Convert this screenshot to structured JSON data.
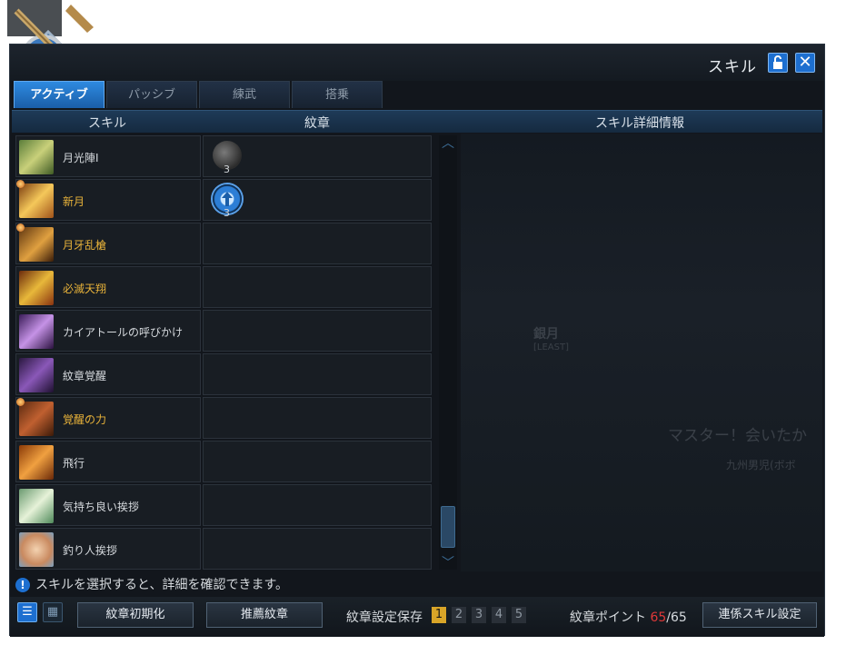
{
  "window": {
    "title": "スキル",
    "tabs": [
      {
        "label": "アクティブ",
        "active": true
      },
      {
        "label": "パッシブ",
        "active": false
      },
      {
        "label": "練武",
        "active": false
      },
      {
        "label": "搭乗",
        "active": false
      }
    ],
    "columns": {
      "skill": "スキル",
      "emblem": "紋章",
      "detail": "スキル詳細情報"
    }
  },
  "skills": [
    {
      "name": "月光陣Ⅰ",
      "gold": false,
      "marked": false,
      "icon": "moon-array-icon",
      "emblem": {
        "icon": "gray-orb-icon",
        "count": "3"
      }
    },
    {
      "name": "新月",
      "gold": true,
      "marked": true,
      "icon": "new-moon-icon",
      "emblem": {
        "icon": "blue-arrow-emblem-icon",
        "count": "3"
      }
    },
    {
      "name": "月牙乱槍",
      "gold": true,
      "marked": true,
      "icon": "crescent-spear-icon",
      "emblem": null
    },
    {
      "name": "必滅天翔",
      "gold": true,
      "marked": false,
      "icon": "heaven-soar-icon",
      "emblem": null
    },
    {
      "name": "カイアトールの呼びかけ",
      "gold": false,
      "marked": false,
      "icon": "kaiatol-call-icon",
      "emblem": null
    },
    {
      "name": "紋章覚醒",
      "gold": false,
      "marked": false,
      "icon": "emblem-awaken-icon",
      "emblem": null
    },
    {
      "name": "覚醒の力",
      "gold": true,
      "marked": true,
      "icon": "awaken-power-icon",
      "emblem": null
    },
    {
      "name": "飛行",
      "gold": false,
      "marked": false,
      "icon": "flight-icon",
      "emblem": null
    },
    {
      "name": "気持ち良い挨拶",
      "gold": false,
      "marked": false,
      "icon": "greeting-icon",
      "emblem": null
    },
    {
      "name": "釣り人挨拶",
      "gold": false,
      "marked": false,
      "icon": "angler-greeting-icon",
      "emblem": null
    }
  ],
  "detail_background": {
    "name": "銀月",
    "sub": "[LEAST]",
    "quote": "マスター！会いたか",
    "subquote": "九州男児(ボボ"
  },
  "hint": "スキルを選択すると、詳細を確認できます。",
  "bottom": {
    "reset_label": "紋章初期化",
    "recommend_label": "推薦紋章",
    "save_label": "紋章設定保存",
    "slots": [
      "1",
      "2",
      "3",
      "4",
      "5"
    ],
    "active_slot": "1",
    "points_label": "紋章ポイント",
    "points_used": "65",
    "points_total": "/65",
    "link_label": "連係スキル設定"
  }
}
